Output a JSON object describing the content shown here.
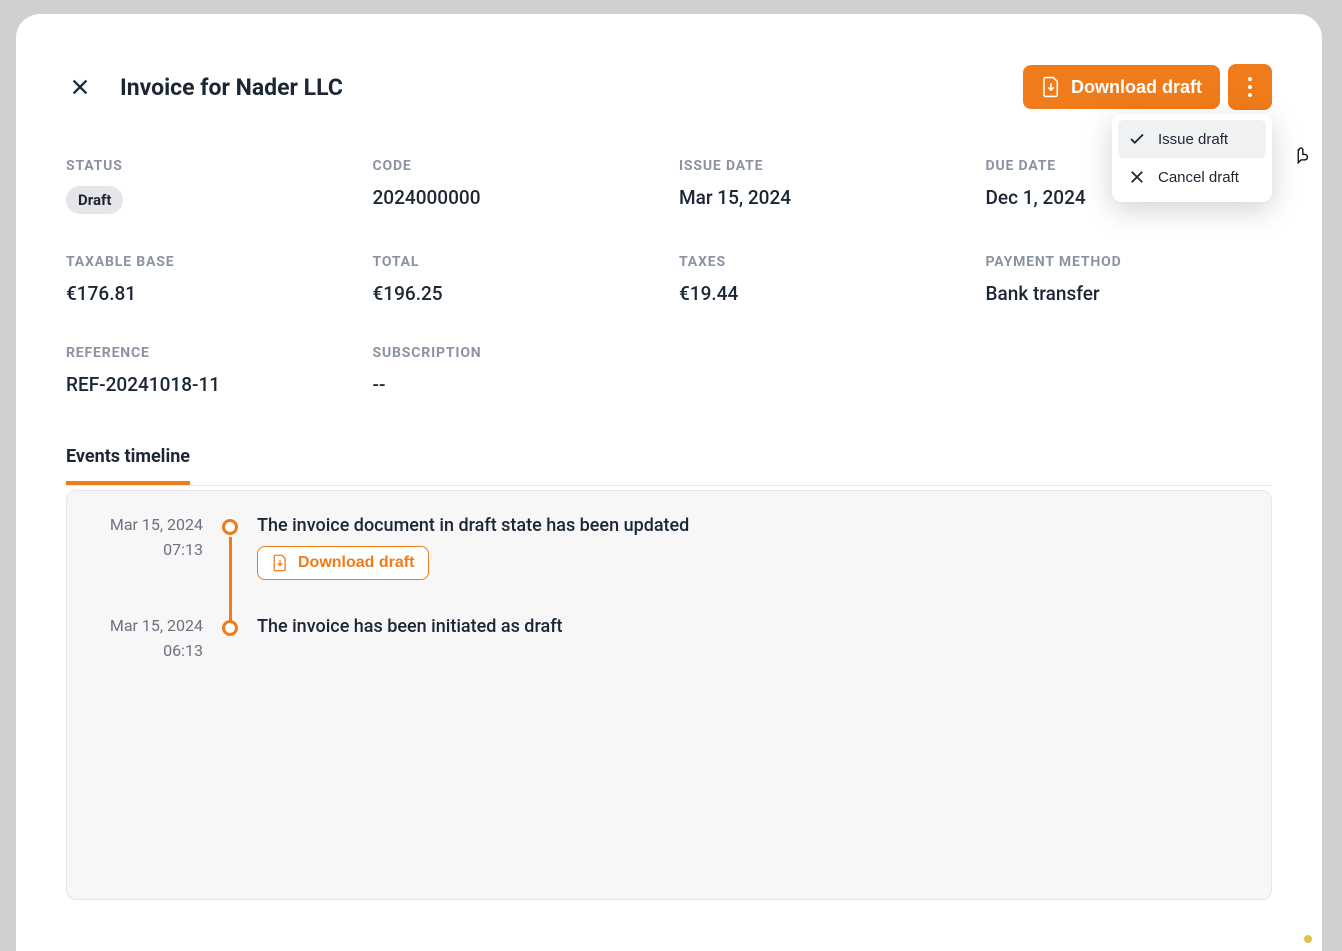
{
  "header": {
    "title": "Invoice for Nader LLC",
    "download_label": "Download draft"
  },
  "dropdown": {
    "issue": "Issue draft",
    "cancel": "Cancel draft"
  },
  "fields": {
    "status_label": "STATUS",
    "status_value": "Draft",
    "code_label": "CODE",
    "code_value": "2024000000",
    "issue_date_label": "ISSUE DATE",
    "issue_date_value": "Mar 15, 2024",
    "due_date_label": "DUE DATE",
    "due_date_value": "Dec 1, 2024",
    "taxable_base_label": "TAXABLE BASE",
    "taxable_base_value": "€176.81",
    "total_label": "TOTAL",
    "total_value": "€196.25",
    "taxes_label": "TAXES",
    "taxes_value": "€19.44",
    "payment_method_label": "PAYMENT METHOD",
    "payment_method_value": "Bank transfer",
    "reference_label": "REFERENCE",
    "reference_value": "REF-20241018-11",
    "subscription_label": "SUBSCRIPTION",
    "subscription_value": "--"
  },
  "tabs": {
    "events": "Events timeline"
  },
  "timeline": [
    {
      "date": "Mar 15, 2024",
      "time": "07:13",
      "text": "The invoice document in draft state has been updated",
      "download_label": "Download draft",
      "has_download": true
    },
    {
      "date": "Mar 15, 2024",
      "time": "06:13",
      "text": "The invoice has been initiated as draft",
      "has_download": false
    }
  ]
}
